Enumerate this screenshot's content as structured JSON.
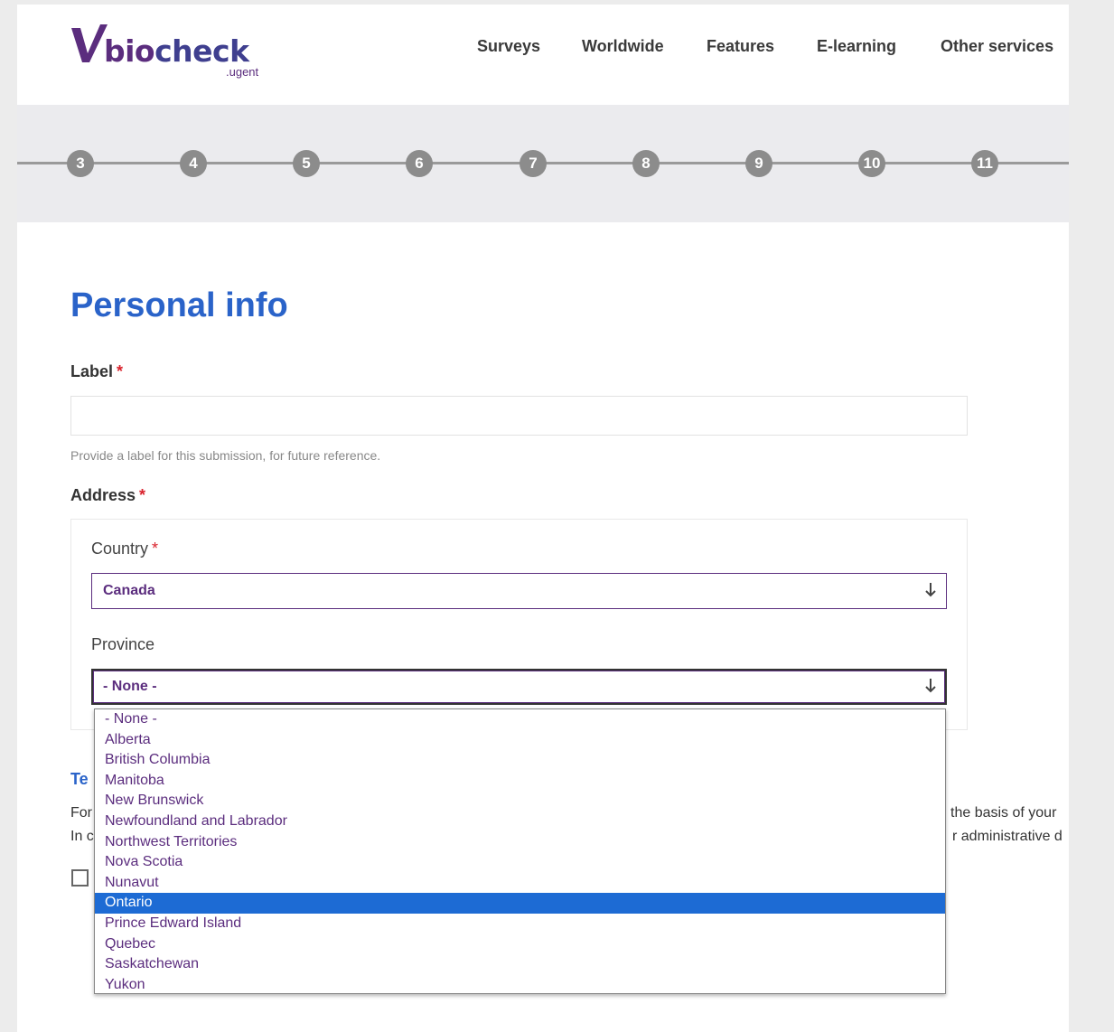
{
  "header": {
    "logo": {
      "text_bio": "bio",
      "text_check": "check",
      "sub": ".ugent",
      "brand_color": "#5b2d7e"
    },
    "nav": [
      {
        "label": "Surveys"
      },
      {
        "label": "Worldwide"
      },
      {
        "label": "Features"
      },
      {
        "label": "E-learning"
      },
      {
        "label": "Other services"
      }
    ]
  },
  "stepper": {
    "steps": [
      "3",
      "4",
      "5",
      "6",
      "7",
      "8",
      "9",
      "10",
      "11"
    ],
    "color": "#8c8c8c"
  },
  "form": {
    "title": "Personal info",
    "label_field": {
      "label": "Label",
      "required_mark": "*",
      "value": "",
      "help": "Provide a label for this submission, for future reference."
    },
    "address": {
      "label": "Address",
      "required_mark": "*",
      "country": {
        "label": "Country",
        "required_mark": "*",
        "value": "Canada"
      },
      "province": {
        "label": "Province",
        "value": "- None -",
        "options": [
          "- None -",
          "Alberta",
          "British Columbia",
          "Manitoba",
          "New Brunswick",
          "Newfoundland and Labrador",
          "Northwest Territories",
          "Nova Scotia",
          "Nunavut",
          "Ontario",
          "Prince Edward Island",
          "Quebec",
          "Saskatchewan",
          "Yukon"
        ],
        "highlighted": "Ontario"
      }
    },
    "terms": {
      "title_visible": "Te",
      "line1_left": "For",
      "line1_right": "the basis of your",
      "line2_left": "In c",
      "line2_right": "r administrative d"
    }
  },
  "colors": {
    "accent_blue": "#2a63c9",
    "brand_purple": "#5b2d7e",
    "selection": "#1d6bd4",
    "required": "#d9232d"
  }
}
